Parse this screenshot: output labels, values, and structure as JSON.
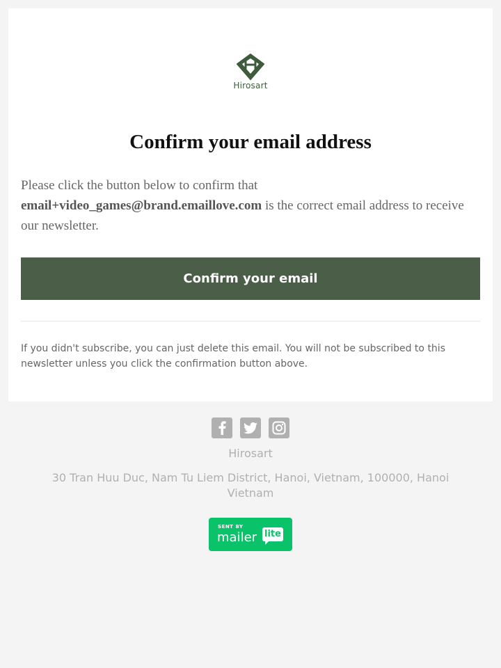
{
  "brand": {
    "name": "Hirosart",
    "logo_text": "Hirosart",
    "logo_color": "#3e5b3b"
  },
  "email": {
    "title": "Confirm your email address",
    "message_prefix": "Please click the button below to confirm that",
    "email_address": "email+video_games@brand.emaillove.com",
    "message_suffix": "is the correct email address to receive our newsletter.",
    "button_label": "Confirm your email",
    "button_color": "#4a5e48",
    "note": "If you didn't subscribe, you can just delete this email. You will not be subscribed to this newsletter unless you click the confirmation button above."
  },
  "footer": {
    "social": [
      {
        "name": "facebook",
        "icon": "facebook-icon"
      },
      {
        "name": "twitter",
        "icon": "twitter-icon"
      },
      {
        "name": "instagram",
        "icon": "instagram-icon"
      }
    ],
    "company": "Hirosart",
    "address": "30 Tran Huu Duc, Nam Tu Liem District, Hanoi, Vietnam, 100000, Hanoi Vietnam",
    "badge": {
      "sent_by": "SENT BY",
      "mailer": "mailer",
      "lite": "lite",
      "color": "#09c269"
    }
  }
}
